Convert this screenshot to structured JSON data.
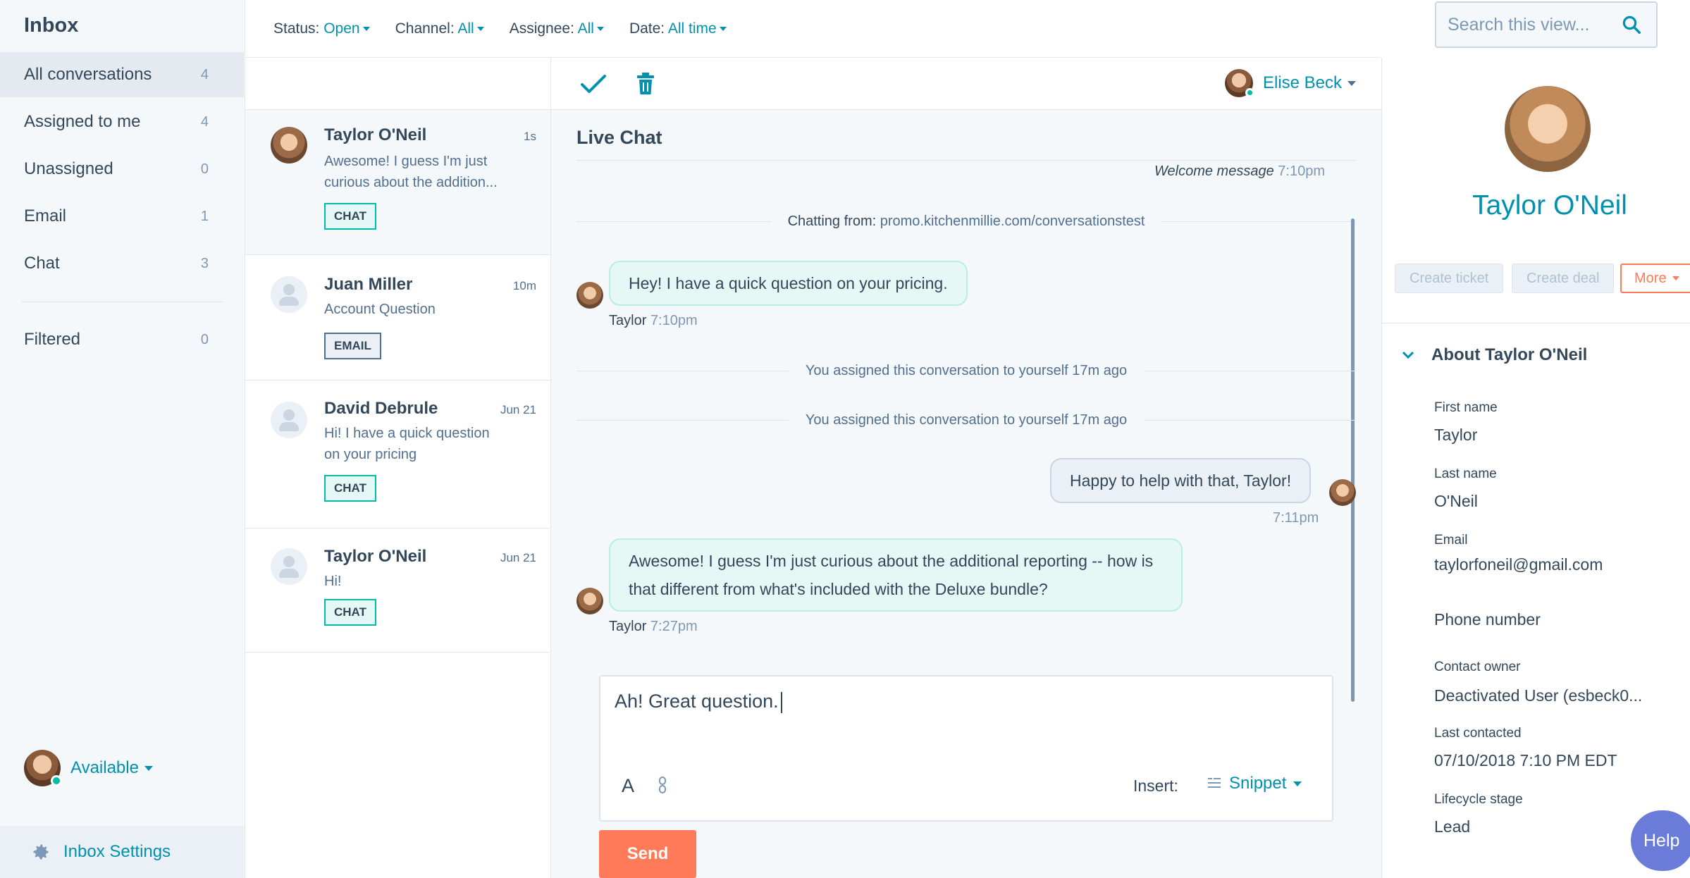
{
  "sidebar": {
    "title": "Inbox",
    "items": [
      {
        "label": "All conversations",
        "count": "4"
      },
      {
        "label": "Assigned to me",
        "count": "4"
      },
      {
        "label": "Unassigned",
        "count": "0"
      },
      {
        "label": "Email",
        "count": "1"
      },
      {
        "label": "Chat",
        "count": "3"
      },
      {
        "label": "Filtered",
        "count": "0"
      }
    ],
    "availability": "Available",
    "settings_label": "Inbox Settings"
  },
  "filters": [
    {
      "label": "Status:",
      "value": "Open"
    },
    {
      "label": "Channel:",
      "value": "All"
    },
    {
      "label": "Assignee:",
      "value": "All"
    },
    {
      "label": "Date:",
      "value": "All time"
    }
  ],
  "search": {
    "placeholder": "Search this view..."
  },
  "conversations": [
    {
      "name": "Taylor O'Neil",
      "time": "1s",
      "preview": "Awesome! I guess I'm just curious about the addition...",
      "tag": "CHAT"
    },
    {
      "name": "Juan Miller",
      "time": "10m",
      "preview": "Account Question",
      "tag": "EMAIL"
    },
    {
      "name": "David Debrule",
      "time": "Jun 21",
      "preview": "Hi! I have a quick question on your pricing",
      "tag": "CHAT"
    },
    {
      "name": "Taylor O'Neil",
      "time": "Jun 21",
      "preview": "Hi!",
      "tag": "CHAT"
    }
  ],
  "chat": {
    "assignee": "Elise Beck",
    "title": "Live Chat",
    "welcome_label": "Welcome message",
    "welcome_time": "7:10pm",
    "chatting_from_label": "Chatting from:",
    "chatting_from_url": "promo.kitchenmillie.com/conversationstest",
    "messages": [
      {
        "text": "Hey! I have a quick question on your pricing.",
        "author": "Taylor",
        "time": "7:10pm"
      },
      {
        "text": "Happy to help with that, Taylor!",
        "time": "7:11pm"
      },
      {
        "text": "Awesome! I guess I'm just curious about the additional reporting -- how is that different from what's included with the Deluxe bundle?",
        "author": "Taylor",
        "time": "7:27pm"
      }
    ],
    "system_events": [
      "You assigned this conversation to yourself 17m ago",
      "You assigned this conversation to yourself 17m ago"
    ]
  },
  "composer": {
    "text": "Ah! Great question.",
    "font_glyph": "A",
    "insert_label": "Insert:",
    "snippet_label": "Snippet",
    "send_label": "Send"
  },
  "contact": {
    "name": "Taylor O'Neil",
    "create_ticket": "Create ticket",
    "create_deal": "Create deal",
    "more": "More",
    "about_title": "About Taylor O'Neil",
    "properties": [
      {
        "label": "First name",
        "value": "Taylor"
      },
      {
        "label": "Last name",
        "value": "O'Neil"
      },
      {
        "label": "Email",
        "value": "taylorfoneil@gmail.com"
      },
      {
        "label": "Phone number",
        "value": ""
      },
      {
        "label": "Contact owner",
        "value": "Deactivated User (esbeck0..."
      },
      {
        "label": "Last contacted",
        "value": "07/10/2018 7:10 PM EDT"
      },
      {
        "label": "Lifecycle stage",
        "value": "Lead"
      }
    ]
  },
  "help_label": "Help",
  "colors": {
    "accent": "#0091ae",
    "send": "#ff7a59",
    "chat_tag": "#00bda5",
    "help": "#6b7cd8"
  }
}
